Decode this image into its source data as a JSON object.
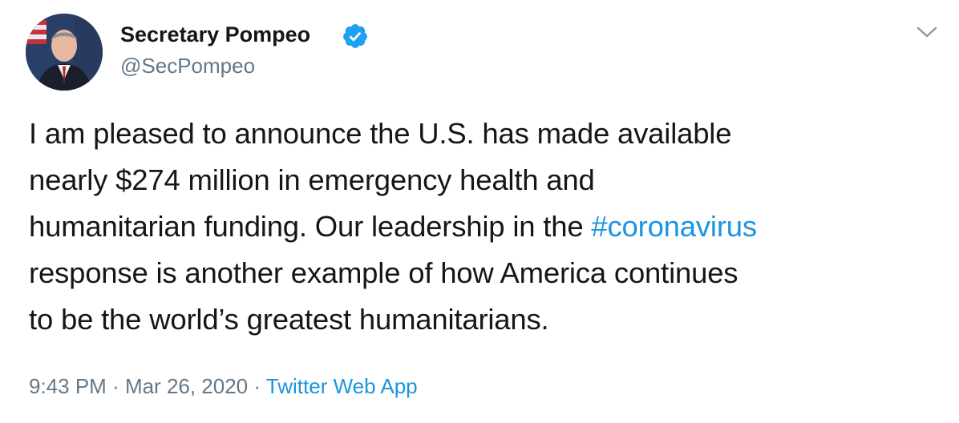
{
  "tweet": {
    "author": {
      "name": "Secretary Pompeo",
      "handle": "@SecPompeo",
      "verified_icon": "verified-badge-icon"
    },
    "menu_icon": "chevron-down-icon",
    "text": {
      "line1": "I am pleased to announce the U.S. has made available",
      "line2": "nearly $274 million in emergency health and",
      "line3_before": "humanitarian funding. Our leadership in the ",
      "hashtag": "#coronavirus",
      "line4": "response is another example of how America continues",
      "line5": "to be the world’s greatest humanitarians."
    },
    "meta": {
      "time": "9:43 PM",
      "separator1": " · ",
      "date": "Mar 26, 2020",
      "separator2": " · ",
      "source": "Twitter Web App"
    }
  },
  "colors": {
    "text": "#14171a",
    "secondary": "#657786",
    "link": "#1b95e0",
    "verified": "#1da1f2"
  }
}
